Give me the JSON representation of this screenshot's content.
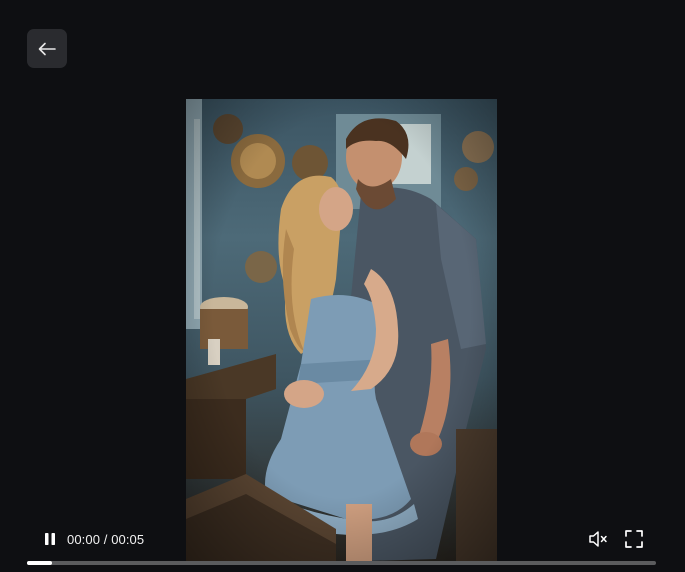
{
  "player": {
    "current_time": "00:00",
    "duration": "00:05",
    "time_separator": " / ",
    "playing": true,
    "muted": true,
    "progress_fraction": 0.04
  },
  "icons": {
    "back": "arrow-left-icon",
    "play_state": "pause-icon",
    "volume": "volume-muted-icon",
    "fullscreen": "fullscreen-icon"
  },
  "colors": {
    "background": "#0e0f12",
    "button_bg": "#2a2b2f",
    "progress_track": "#5a5b5e",
    "progress_fill": "#ffffff"
  }
}
